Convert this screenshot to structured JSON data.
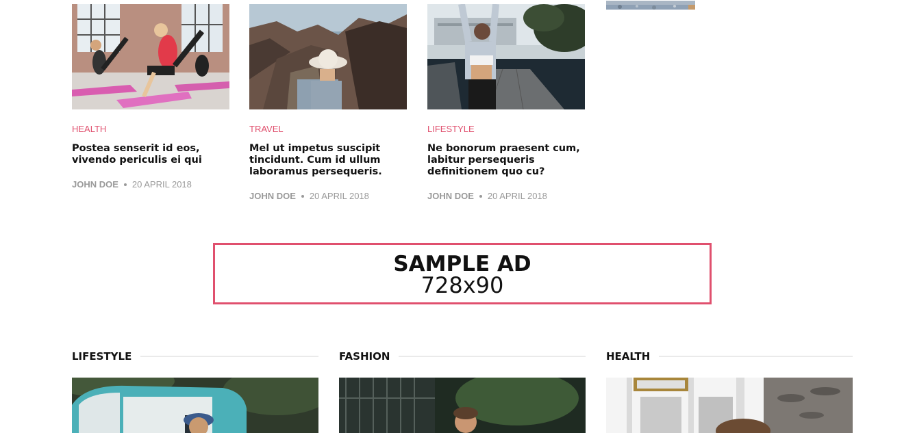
{
  "articles": [
    {
      "category": "HEALTH",
      "title": "Postea senserit id eos, vivendo periculis ei qui",
      "author": "JOHN DOE",
      "date": "20 APRIL 2018",
      "image": "fitness-class-photo"
    },
    {
      "category": "TRAVEL",
      "title": "Mel ut impetus suscipit tincidunt. Cum id ullum laboramus persequeris.",
      "author": "JOHN DOE",
      "date": "20 APRIL 2018",
      "image": "hiker-canyon-photo"
    },
    {
      "category": "LIFESTYLE",
      "title": "Ne bonorum praesent cum, labitur persequeris definitionem quo cu?",
      "author": "JOHN DOE",
      "date": "20 APRIL 2018",
      "image": "woman-stretching-pier-photo"
    }
  ],
  "ad": {
    "title": "SAMPLE AD",
    "size": "728x90",
    "border_color": "#e0506e"
  },
  "sections": [
    {
      "label": "LIFESTYLE",
      "image": "vintage-truck-photo"
    },
    {
      "label": "FASHION",
      "image": "man-street-photo"
    },
    {
      "label": "HEALTH",
      "image": "dog-window-photo"
    }
  ],
  "colors": {
    "accent": "#e0506e",
    "meta": "#999999",
    "text": "#111111"
  }
}
